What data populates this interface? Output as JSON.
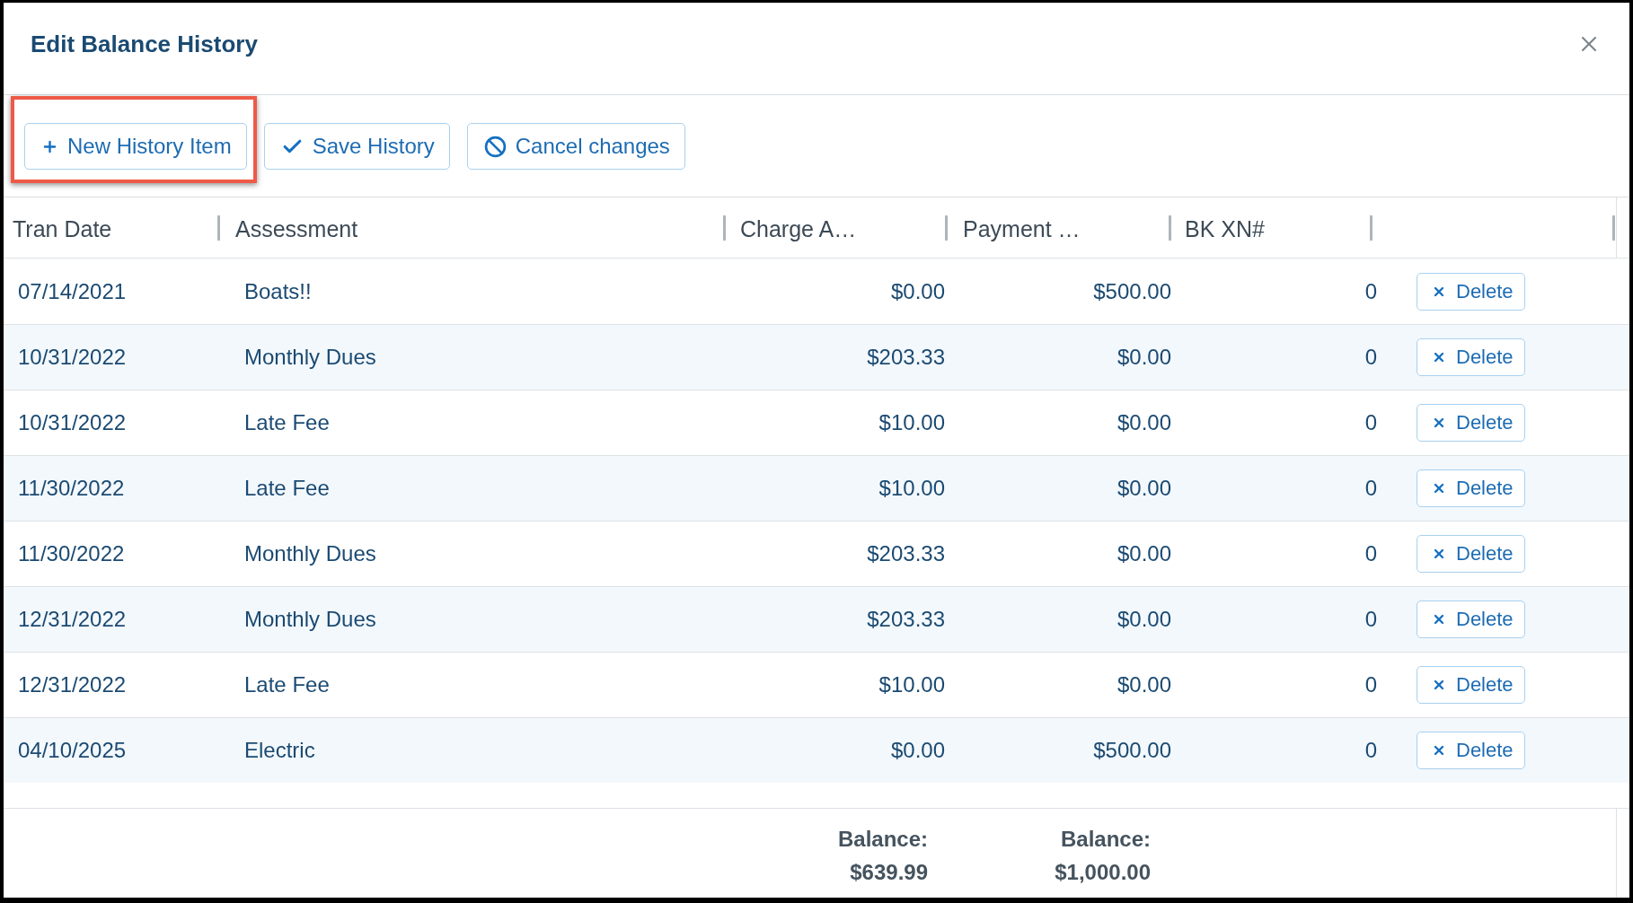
{
  "dialog": {
    "title": "Edit Balance History"
  },
  "toolbar": {
    "buttons": [
      {
        "kind": "add",
        "label": "New History Item",
        "highlighted": true
      },
      {
        "kind": "save",
        "label": "Save History",
        "highlighted": false
      },
      {
        "kind": "cancel",
        "label": "Cancel changes",
        "highlighted": false
      }
    ]
  },
  "table": {
    "columns": [
      "Tran Date",
      "Assessment",
      "Charge A…",
      "Payment …",
      "BK XN#"
    ],
    "rows": [
      {
        "tran_date": "07/14/2021",
        "assessment": "Boats!!",
        "charge": "$0.00",
        "payment": "$500.00",
        "bk_xn": "0",
        "action": "Delete"
      },
      {
        "tran_date": "10/31/2022",
        "assessment": "Monthly Dues",
        "charge": "$203.33",
        "payment": "$0.00",
        "bk_xn": "0",
        "action": "Delete"
      },
      {
        "tran_date": "10/31/2022",
        "assessment": "Late Fee",
        "charge": "$10.00",
        "payment": "$0.00",
        "bk_xn": "0",
        "action": "Delete"
      },
      {
        "tran_date": "11/30/2022",
        "assessment": "Late Fee",
        "charge": "$10.00",
        "payment": "$0.00",
        "bk_xn": "0",
        "action": "Delete"
      },
      {
        "tran_date": "11/30/2022",
        "assessment": "Monthly Dues",
        "charge": "$203.33",
        "payment": "$0.00",
        "bk_xn": "0",
        "action": "Delete"
      },
      {
        "tran_date": "12/31/2022",
        "assessment": "Monthly Dues",
        "charge": "$203.33",
        "payment": "$0.00",
        "bk_xn": "0",
        "action": "Delete"
      },
      {
        "tran_date": "12/31/2022",
        "assessment": "Late Fee",
        "charge": "$10.00",
        "payment": "$0.00",
        "bk_xn": "0",
        "action": "Delete"
      },
      {
        "tran_date": "04/10/2025",
        "assessment": "Electric",
        "charge": "$0.00",
        "payment": "$500.00",
        "bk_xn": "0",
        "action": "Delete"
      }
    ],
    "footer": {
      "charge_total": {
        "label": "Balance:",
        "value": "$639.99"
      },
      "payment_total": {
        "label": "Balance:",
        "value": "$1,000.00"
      }
    }
  }
}
